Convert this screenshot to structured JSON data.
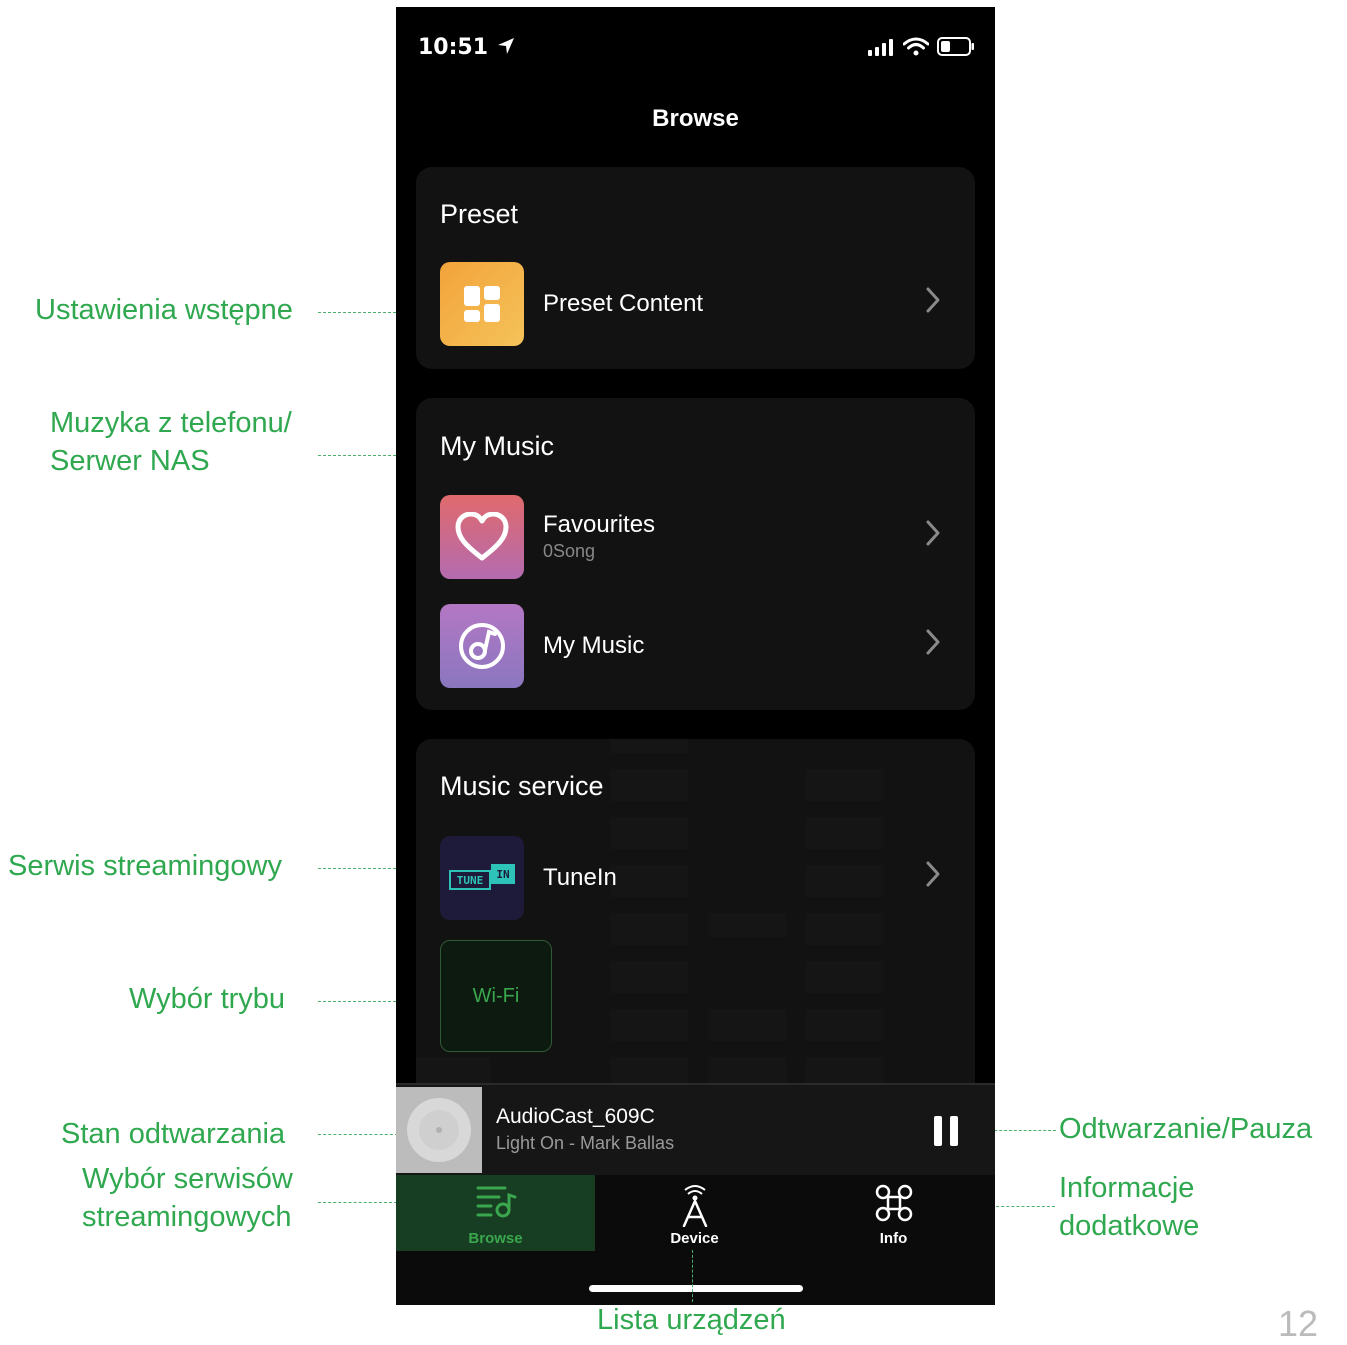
{
  "status": {
    "time": "10:51"
  },
  "header": {
    "title": "Browse"
  },
  "preset": {
    "title": "Preset",
    "items": [
      {
        "label": "Preset Content"
      }
    ]
  },
  "my_music": {
    "title": "My Music",
    "items": [
      {
        "label": "Favourites",
        "sub": "0Song"
      },
      {
        "label": "My Music"
      }
    ]
  },
  "music_service": {
    "title": "Music service",
    "items": [
      {
        "label": "TuneIn",
        "logo_tune": "TUNE",
        "logo_in": "IN"
      }
    ],
    "mode_tile": "Wi-Fi"
  },
  "player": {
    "title": "AudioCast_609C",
    "subtitle": "Light On - Mark Ballas"
  },
  "tabs": [
    {
      "label": "Browse",
      "active": true
    },
    {
      "label": "Device",
      "active": false
    },
    {
      "label": "Info",
      "active": false
    }
  ],
  "annotations": {
    "preset": "Ustawienia wstępne",
    "my_music_line1": "Muzyka z telefonu/",
    "my_music_line2": "Serwer NAS",
    "streaming": "Serwis streamingowy",
    "mode": "Wybór trybu",
    "playback_state": "Stan odtwarzania",
    "services_line1": "Wybór serwisów",
    "services_line2": "streamingowych",
    "play_pause": "Odtwarzanie/Pauza",
    "info_line1": "Informacje",
    "info_line2": "dodatkowe",
    "device_list": "Lista urządzeń"
  },
  "page_number": "12",
  "colors": {
    "annotation": "#2fa84f",
    "accent_tab": "#1d4d2b",
    "background": "#000000"
  }
}
